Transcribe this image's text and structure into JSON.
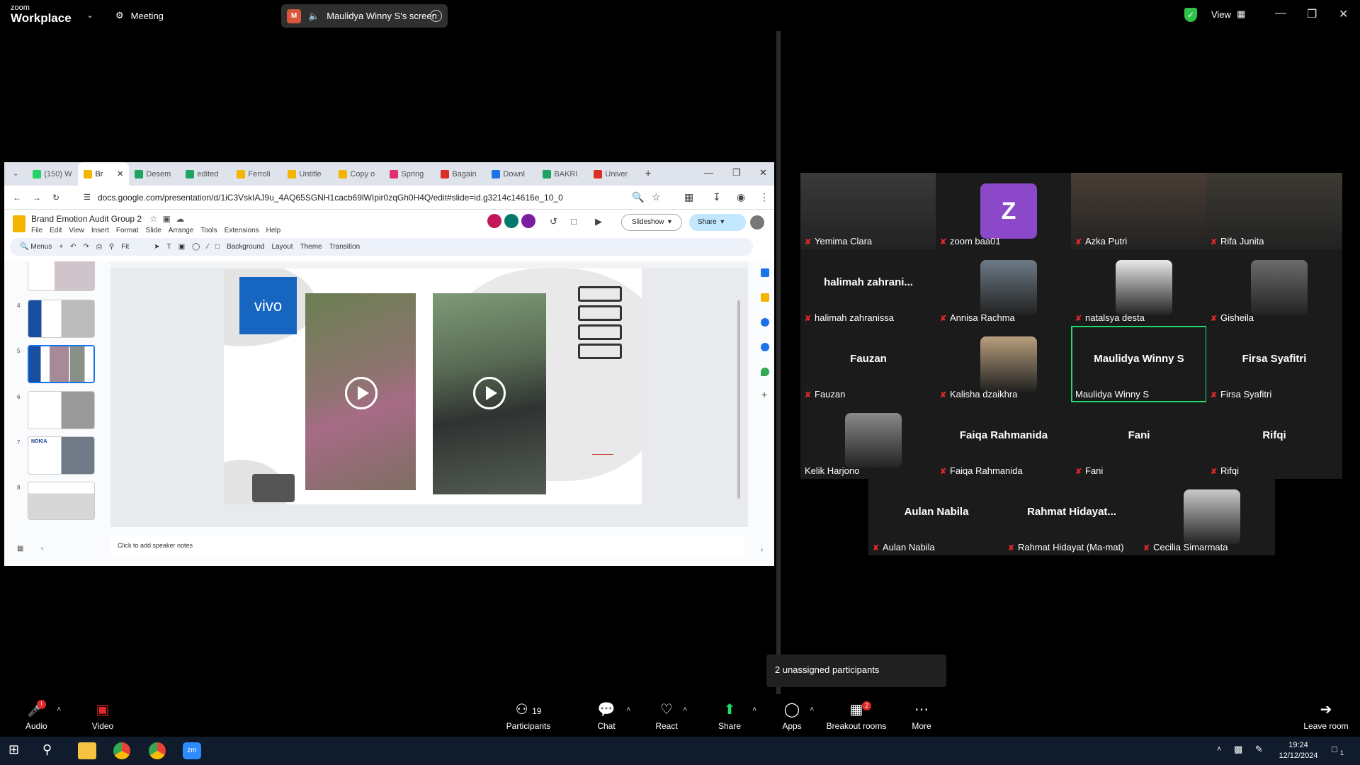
{
  "zoom": {
    "brand_top": "zoom",
    "brand_bottom": "Workplace",
    "meeting_label": "Meeting",
    "screen_share_label": "Maulidya Winny S's screen",
    "view_label": "View"
  },
  "browser": {
    "tabs": [
      {
        "label": "(150) W",
        "color": "#25d366"
      },
      {
        "label": "Br",
        "color": "#f5b400"
      },
      {
        "label": "Desem",
        "color": "#1ea362"
      },
      {
        "label": "edited",
        "color": "#1ea362"
      },
      {
        "label": "Ferroli",
        "color": "#f5b400"
      },
      {
        "label": "Untitle",
        "color": "#f5b400"
      },
      {
        "label": "Copy o",
        "color": "#f5b400"
      },
      {
        "label": "Spring",
        "color": "#e1306c"
      },
      {
        "label": "Bagain",
        "color": "#d93025"
      },
      {
        "label": "Downl",
        "color": "#1a73e8"
      },
      {
        "label": "BAKRI",
        "color": "#1ea362"
      },
      {
        "label": "Univer",
        "color": "#d93025"
      }
    ],
    "url": "docs.google.com/presentation/d/1iC3VskIAJ9u_4AQ65SGNH1cacb69lWIpir0zqGh0H4Q/edit#slide=id.g3214c14616e_10_0",
    "doc_title": "Brand Emotion Audit Group 2",
    "menus": [
      "File",
      "Edit",
      "View",
      "Insert",
      "Format",
      "Slide",
      "Arrange",
      "Tools",
      "Extensions",
      "Help"
    ],
    "slideshow_label": "Slideshow",
    "share_label": "Share",
    "toolbar": {
      "menus_label": "Menus",
      "zoom_label": "Fit",
      "background": "Background",
      "layout": "Layout",
      "theme": "Theme",
      "transition": "Transition"
    },
    "thumb_numbers": [
      "4",
      "5",
      "6",
      "7",
      "8"
    ],
    "slide_logo": "vivo",
    "thumb_brand_nokia": "NOKIA",
    "speaker_notes_placeholder": "Click to add speaker notes"
  },
  "participants": [
    {
      "name": "Yemima Clara",
      "big": "",
      "color": "#3a3a3a",
      "muted": true
    },
    {
      "name": "zoom baa01",
      "big": "",
      "color": "#8b48c9",
      "muted": true,
      "initial": "Z"
    },
    {
      "name": "Azka Putri",
      "big": "",
      "color": "#4a3d35",
      "muted": true
    },
    {
      "name": "Rifa Junita",
      "big": "",
      "color": "#3d3a33",
      "muted": true
    },
    {
      "name": "halimah zahranissa",
      "big": "halimah  zahrani...",
      "color": "",
      "muted": true
    },
    {
      "name": "Annisa Rachma",
      "big": "",
      "color": "#6c7a86",
      "muted": true
    },
    {
      "name": "natalsya desta",
      "big": "",
      "color": "#e9e9e9",
      "muted": true
    },
    {
      "name": "Gisheila",
      "big": "",
      "color": "#6b6b6b",
      "muted": true
    },
    {
      "name": "Fauzan",
      "big": "Fauzan",
      "color": "",
      "muted": true
    },
    {
      "name": "Kalisha dzaikhra",
      "big": "",
      "color": "#b99f7d",
      "muted": true
    },
    {
      "name": "Maulidya Winny S",
      "big": "Maulidya Winny S",
      "color": "",
      "muted": false
    },
    {
      "name": "Firsa Syafitri",
      "big": "Firsa Syafitri",
      "color": "",
      "muted": true
    },
    {
      "name": "Kelik Harjono",
      "big": "",
      "color": "#8a8a8a",
      "muted": false
    },
    {
      "name": "Faiqa Rahmanida",
      "big": "Faiqa Rahmanida",
      "color": "",
      "muted": true
    },
    {
      "name": "Fani",
      "big": "Fani",
      "color": "",
      "muted": true
    },
    {
      "name": "Rifqi",
      "big": "Rifqi",
      "color": "",
      "muted": true
    },
    {
      "name": "Aulan Nabila",
      "big": "Aulan Nabila",
      "color": "",
      "muted": true
    },
    {
      "name": "Rahmat Hidayat (Ma-mat)",
      "big": "Rahmat  Hidayat...",
      "color": "",
      "muted": true
    },
    {
      "name": "Cecilia Simarmata",
      "big": "",
      "color": "#c9c9c9",
      "muted": true
    }
  ],
  "unassigned_text": "2 unassigned participants",
  "controls": {
    "audio": "Audio",
    "video": "Video",
    "participants": "Participants",
    "participants_count": "19",
    "chat": "Chat",
    "react": "React",
    "share": "Share",
    "apps": "Apps",
    "breakout": "Breakout rooms",
    "breakout_badge": "2",
    "more": "More",
    "leave": "Leave room"
  },
  "taskbar": {
    "time": "19:24",
    "date": "12/12/2024",
    "notif_count": "1"
  }
}
